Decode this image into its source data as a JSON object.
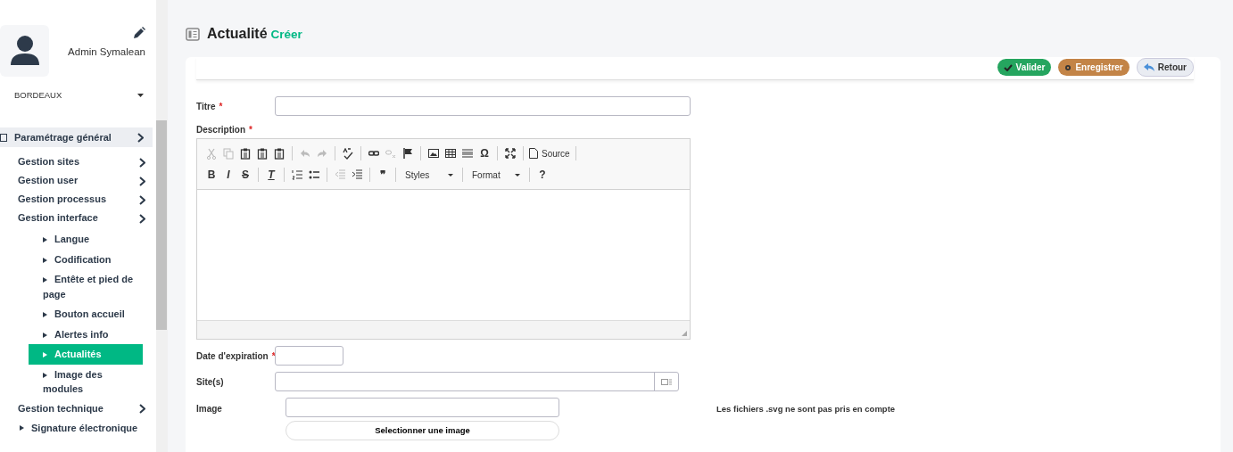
{
  "user": {
    "name": "Admin Symalean"
  },
  "site_select": {
    "value": "BORDEAUX"
  },
  "menu": [
    {
      "label": "Paramétrage général",
      "kind": "group",
      "selected": false,
      "children": [
        {
          "label": "Gestion sites",
          "kind": "group",
          "selected": false
        },
        {
          "label": "Gestion user",
          "kind": "group",
          "selected": false
        },
        {
          "label": "Gestion processus",
          "kind": "group",
          "selected": false
        },
        {
          "label": "Gestion interface",
          "kind": "group",
          "selected": false,
          "children": [
            {
              "label": "Langue",
              "kind": "leaf",
              "selected": false
            },
            {
              "label": "Codification",
              "kind": "leaf",
              "selected": false
            },
            {
              "label": "Entête et pied de page",
              "kind": "leaf",
              "selected": false
            },
            {
              "label": "Bouton accueil",
              "kind": "leaf",
              "selected": false
            },
            {
              "label": "Alertes info",
              "kind": "leaf",
              "selected": false
            },
            {
              "label": "Actualités",
              "kind": "leaf",
              "selected": true
            },
            {
              "label": "Image des modules",
              "kind": "leaf",
              "selected": false
            }
          ]
        },
        {
          "label": "Gestion technique",
          "kind": "group",
          "selected": false
        },
        {
          "label": "Signature électronique",
          "kind": "leaf",
          "selected": false
        }
      ]
    }
  ],
  "page": {
    "title": "Actualité",
    "subtitle": "Créer"
  },
  "actions": [
    {
      "label": "Valider",
      "kind": "validate"
    },
    {
      "label": "Enregistrer",
      "kind": "save"
    },
    {
      "label": "Retour",
      "kind": "back"
    }
  ],
  "form": {
    "required_mark": "*",
    "title_label": "Titre",
    "description_label": "Description",
    "date_label": "Date d'expiration",
    "sites_label": "Site(s)",
    "image_label": "Image",
    "image_button": "Selectionner une image",
    "image_note": "Les fichiers .svg ne sont pas pris en compte"
  },
  "editor_toolbar": [
    [
      {
        "kind": "cut",
        "disabled": true
      },
      {
        "kind": "copy",
        "disabled": true
      },
      {
        "kind": "paste",
        "disabled": false
      },
      {
        "kind": "paste",
        "disabled": false
      },
      {
        "kind": "paste",
        "disabled": false
      },
      {
        "kind": "sep"
      },
      {
        "kind": "undo",
        "disabled": true
      },
      {
        "kind": "redo",
        "disabled": true
      },
      {
        "kind": "sep"
      },
      {
        "kind": "spell",
        "disabled": false
      },
      {
        "kind": "sep"
      },
      {
        "kind": "link",
        "disabled": false
      },
      {
        "kind": "unlink",
        "disabled": true
      },
      {
        "kind": "flag",
        "disabled": false
      },
      {
        "kind": "sep"
      },
      {
        "kind": "image",
        "disabled": false
      },
      {
        "kind": "table",
        "disabled": false
      },
      {
        "kind": "rule",
        "disabled": false
      },
      {
        "kind": "text",
        "label": "Ω",
        "disabled": false
      },
      {
        "kind": "sep"
      },
      {
        "kind": "maximize",
        "disabled": false
      },
      {
        "kind": "sep"
      },
      {
        "kind": "source",
        "label": "Source",
        "disabled": false
      },
      {
        "kind": "sep"
      }
    ],
    [
      {
        "kind": "text",
        "label": "B",
        "disabled": false
      },
      {
        "kind": "text",
        "label": "I",
        "disabled": false
      },
      {
        "kind": "text",
        "label": "S",
        "disabled": false
      },
      {
        "kind": "sep"
      },
      {
        "kind": "clear",
        "label": "T",
        "disabled": false
      },
      {
        "kind": "sep"
      },
      {
        "kind": "olist",
        "disabled": false
      },
      {
        "kind": "ulist",
        "disabled": false
      },
      {
        "kind": "sep"
      },
      {
        "kind": "outdent",
        "disabled": true
      },
      {
        "kind": "indent",
        "disabled": false
      },
      {
        "kind": "sep"
      },
      {
        "kind": "text",
        "label": "❞",
        "disabled": false
      },
      {
        "kind": "sep"
      },
      {
        "kind": "combo",
        "label": "Styles",
        "disabled": false
      },
      {
        "kind": "sep"
      },
      {
        "kind": "combo",
        "label": "Format",
        "disabled": false
      },
      {
        "kind": "sep"
      },
      {
        "kind": "text",
        "label": "?",
        "disabled": false
      }
    ]
  ]
}
